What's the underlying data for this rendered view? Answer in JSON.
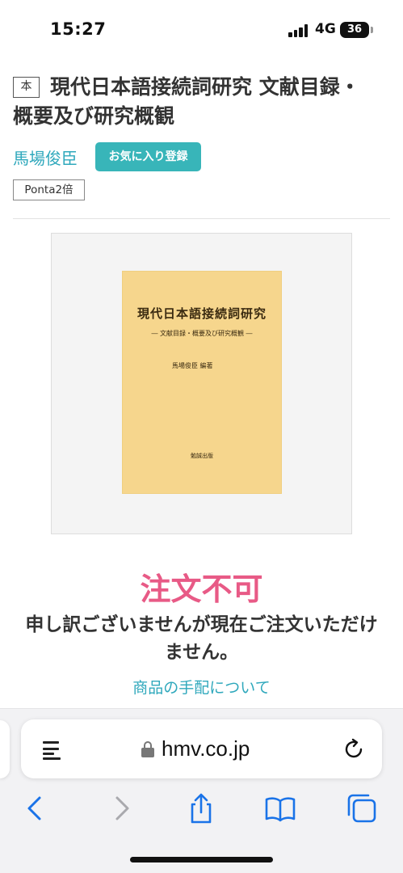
{
  "status_bar": {
    "time": "15:27",
    "network": "4G",
    "battery": "36"
  },
  "product": {
    "type_badge": "本",
    "title": "現代日本語接続詞研究 文献目録・概要及び研究概観",
    "author": "馬場俊臣",
    "favorite_button": "お気に入り登録",
    "points_badge": "Ponta2倍"
  },
  "cover": {
    "title": "現代日本語接続詞研究",
    "subtitle": "― 文献目録・概要及び研究概観 ―",
    "editor": "馬場俊臣 編著",
    "publisher": "勉誠出版"
  },
  "order": {
    "status": "注文不可",
    "message": "申し訳ございませんが現在ご注文いただけません。",
    "link": "商品の手配について"
  },
  "browser": {
    "url": "hmv.co.jp",
    "accent_color": "#1a73e8"
  },
  "colors": {
    "link": "#2fa8bc",
    "button": "#38b5b9",
    "unavailable": "#e85a86"
  }
}
